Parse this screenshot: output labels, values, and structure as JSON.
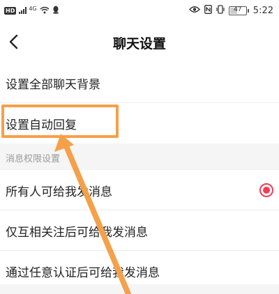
{
  "status_bar": {
    "hd": "HD",
    "signal": "4G",
    "time": "5:22",
    "battery": "47",
    "battery_level": 0.47
  },
  "nav": {
    "title": "聊天设置"
  },
  "rows": [
    {
      "label": "设置全部聊天背景"
    },
    {
      "label": "设置自动回复"
    }
  ],
  "section": {
    "header": "消息权限设置",
    "options": [
      {
        "label": "所有人可给我发消息",
        "selected": true
      },
      {
        "label": "仅互相关注后可给我发消息",
        "selected": false
      },
      {
        "label": "通过任意认证后可给我发消息",
        "selected": false
      }
    ]
  },
  "colors": {
    "accent": "#f33c54",
    "annotation": "#f5a04a",
    "section_bg": "#f5f5f5"
  }
}
